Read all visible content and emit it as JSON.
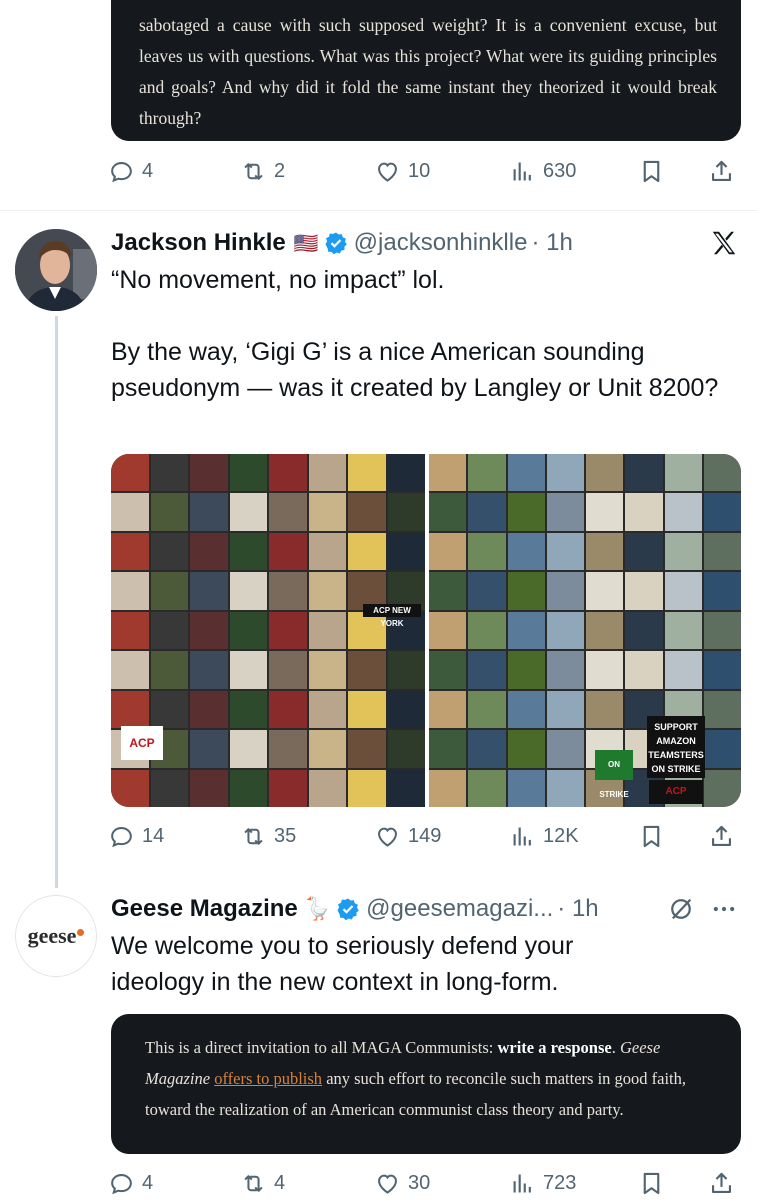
{
  "tweet0": {
    "quote_text": "sabotaged a cause with such supposed weight? It is a convenient excuse, but leaves us with questions. What was this project? What were its guiding principles and goals? And why did it fold the same instant they theorized it would break through?",
    "stats": {
      "replies": "4",
      "reposts": "2",
      "likes": "10",
      "views": "630"
    }
  },
  "tweet1": {
    "name": "Jackson Hinkle",
    "flag": "🇺🇸",
    "handle": "@jacksonhinklle",
    "time": "· 1h",
    "line1": "“No movement, no impact” lol.",
    "line2": "By the way, ‘Gigi G’ is a nice American sounding pseudonym — was it created by Langley or Unit 8200?",
    "media_left": {
      "banner": "ACP NEW YORK",
      "logo": "ACP"
    },
    "media_right": {
      "sign1": "SUPPORT AMAZON TEAMSTERS ON STRIKE",
      "sign2": "ON STRIKE",
      "sign3": "ACP"
    },
    "stats": {
      "replies": "14",
      "reposts": "35",
      "likes": "149",
      "views": "12K"
    }
  },
  "tweet2": {
    "name": "Geese Magazine",
    "emoji": "🪿",
    "handle": "@geesemagazi...",
    "time": "· 1h",
    "avatar_text": "geese",
    "text": "We welcome you to seriously defend your ideology in the new context in long-form.",
    "quote": {
      "p1": "This is a direct invitation to all MAGA Communists: ",
      "bold": "write a response",
      "p2": ". ",
      "ital": "Geese Magazine",
      "p3": " ",
      "link": "offers to publish",
      "p4": " any such effort to reconcile such matters in good faith, toward the realization of an American communist class theory and party."
    },
    "stats": {
      "replies": "4",
      "reposts": "4",
      "likes": "30",
      "views": "723"
    }
  },
  "colors": {
    "accent": "#1d9bf0",
    "secondary_text": "#536471",
    "quote_bg": "#15181c",
    "link": "#d4833e"
  },
  "icons": [
    "reply-icon",
    "repost-icon",
    "like-icon",
    "views-icon",
    "bookmark-icon",
    "share-icon",
    "verified-badge-icon",
    "x-logo-icon",
    "grok-icon",
    "more-icon"
  ]
}
